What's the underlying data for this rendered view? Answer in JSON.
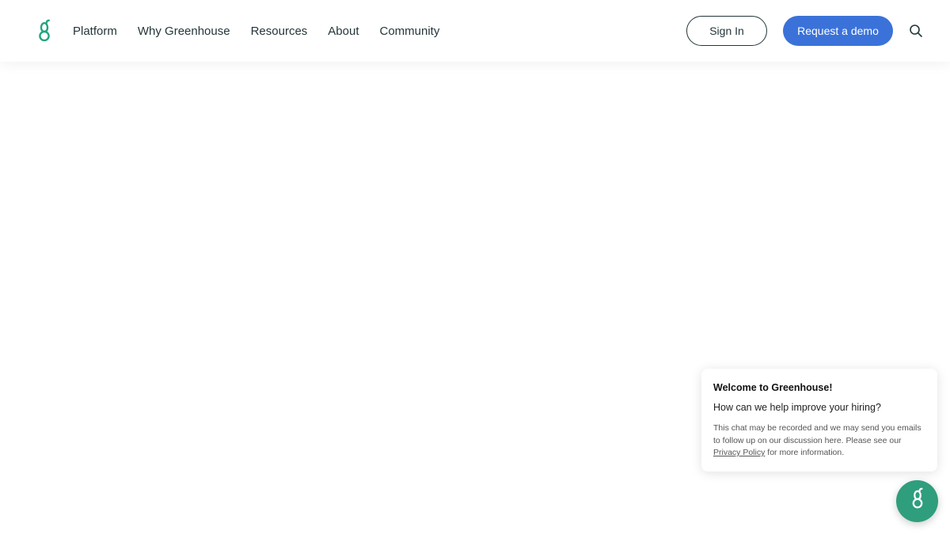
{
  "header": {
    "logo_icon": "greenhouse-g-logo",
    "nav": [
      {
        "label": "Platform"
      },
      {
        "label": "Why Greenhouse"
      },
      {
        "label": "Resources"
      },
      {
        "label": "About"
      },
      {
        "label": "Community"
      }
    ],
    "sign_in_label": "Sign In",
    "demo_label": "Request a demo",
    "search_icon": "search-icon"
  },
  "chat": {
    "title": "Welcome to Greenhouse!",
    "question": "How can we help improve your hiring?",
    "disclaimer_before": "This chat may be recorded and we may send you emails to follow up on our discussion here. Please see our ",
    "privacy_link": "Privacy Policy",
    "disclaimer_after": " for more information.",
    "launcher_icon": "greenhouse-g-logo"
  },
  "colors": {
    "brand_green": "#24a47f",
    "nav_text": "#24363a",
    "demo_button": "#3b72d9",
    "launcher": "#2e9e7c"
  }
}
